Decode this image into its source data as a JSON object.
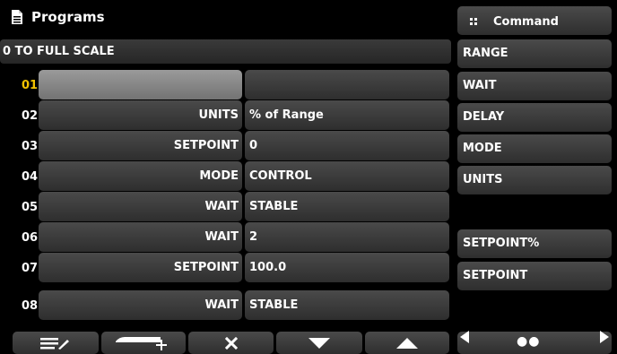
{
  "header": {
    "title": "Programs",
    "icon": "document-icon"
  },
  "program": {
    "name": "0 TO FULL SCALE"
  },
  "steps": [
    {
      "num": "01",
      "name": "",
      "value": ""
    },
    {
      "num": "02",
      "name": "UNITS",
      "value": "% of Range"
    },
    {
      "num": "03",
      "name": "SETPOINT",
      "value": "0"
    },
    {
      "num": "04",
      "name": "MODE",
      "value": "CONTROL"
    },
    {
      "num": "05",
      "name": "WAIT",
      "value": "STABLE"
    },
    {
      "num": "06",
      "name": "WAIT",
      "value": "2"
    },
    {
      "num": "07",
      "name": "SETPOINT",
      "value": "100.0"
    },
    {
      "num": "08",
      "name": "WAIT",
      "value": "STABLE"
    }
  ],
  "command": {
    "label": "Command",
    "icon": "grid-icon"
  },
  "commands": [
    "RANGE",
    "WAIT",
    "DELAY",
    "MODE",
    "UNITS",
    "SETPOINT%",
    "SETPOINT"
  ],
  "toolbar": {
    "icons": [
      "edit-list-icon",
      "insert-icon",
      "delete-icon",
      "move-down-icon",
      "move-up-icon"
    ]
  },
  "pager": {
    "prev": "left-arrow-icon",
    "dots": "●●",
    "next": "right-arrow-icon"
  },
  "colors": {
    "selected_step_number": "#f2c200",
    "selected_row": "#8a8a8a"
  }
}
